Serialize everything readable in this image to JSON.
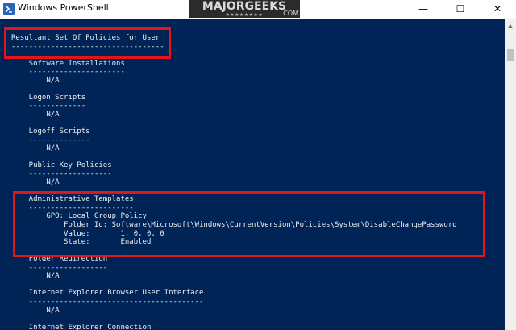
{
  "window": {
    "title": "Windows PowerShell",
    "minimize_glyph": "—",
    "maximize_glyph": "☐",
    "close_glyph": "✕",
    "icon": "powershell-icon"
  },
  "watermark": {
    "text": "MAJORGEEKS",
    "dots": "★★★★★★★★",
    "suffix": ".COM"
  },
  "colors": {
    "console_bg": "#012456",
    "console_text": "#eeedf0",
    "highlight": "#e4141b"
  },
  "console": {
    "lines": [
      "Resultant Set Of Policies for User",
      "-----------------------------------",
      "",
      "    Software Installations",
      "    ----------------------",
      "        N/A",
      "",
      "    Logon Scripts",
      "    -------------",
      "        N/A",
      "",
      "    Logoff Scripts",
      "    --------------",
      "        N/A",
      "",
      "    Public Key Policies",
      "    -------------------",
      "        N/A",
      "",
      "    Administrative Templates",
      "    ------------------------",
      "        GPO: Local Group Policy",
      "            Folder Id: Software\\Microsoft\\Windows\\CurrentVersion\\Policies\\System\\DisableChangePassword",
      "            Value:       1, 0, 0, 0",
      "            State:       Enabled",
      "",
      "    Folder Redirection",
      "    ------------------",
      "        N/A",
      "",
      "    Internet Explorer Browser User Interface",
      "    ----------------------------------------",
      "        N/A",
      "",
      "    Internet Explorer Connection"
    ]
  }
}
